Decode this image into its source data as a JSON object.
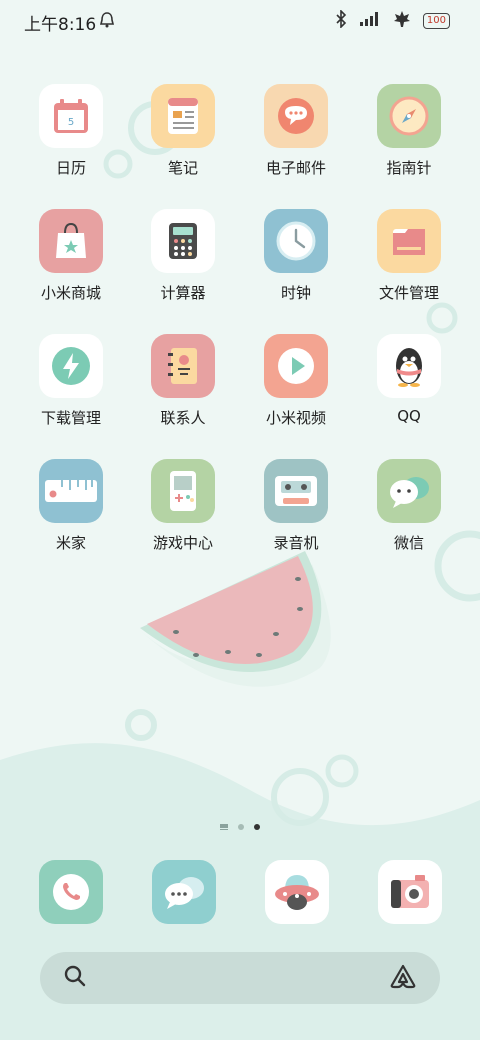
{
  "status_bar": {
    "time": "上午8:16",
    "alarm_icon": "alarm-bell-icon",
    "bluetooth_icon": "bluetooth-icon",
    "signal_icon": "signal-bars-icon",
    "wifi_icon": "maple-leaf-wifi-icon",
    "battery_level": "100"
  },
  "apps": [
    {
      "label": "日历",
      "icon": "calendar-icon",
      "color": "#ffffff"
    },
    {
      "label": "笔记",
      "icon": "notes-icon",
      "color": "#fbd9a0"
    },
    {
      "label": "电子邮件",
      "icon": "email-icon",
      "color": "#f8d8b0"
    },
    {
      "label": "指南针",
      "icon": "compass-icon",
      "color": "#b4d3a4"
    },
    {
      "label": "小米商城",
      "icon": "shopping-bag-icon",
      "color": "#e7a1a1"
    },
    {
      "label": "计算器",
      "icon": "calculator-icon",
      "color": "#ffffff"
    },
    {
      "label": "时钟",
      "icon": "clock-icon",
      "color": "#8fc1d2"
    },
    {
      "label": "文件管理",
      "icon": "folder-icon",
      "color": "#fbd9a0"
    },
    {
      "label": "下载管理",
      "icon": "download-bolt-icon",
      "color": "#ffffff"
    },
    {
      "label": "联系人",
      "icon": "contacts-book-icon",
      "color": "#e7a1a1"
    },
    {
      "label": "小米视频",
      "icon": "video-play-icon",
      "color": "#f3a491"
    },
    {
      "label": "QQ",
      "icon": "penguin-icon",
      "color": "#ffffff"
    },
    {
      "label": "米家",
      "icon": "ruler-home-icon",
      "color": "#8fc1d2"
    },
    {
      "label": "游戏中心",
      "icon": "gameboy-icon",
      "color": "#b4d3a4"
    },
    {
      "label": "录音机",
      "icon": "cassette-icon",
      "color": "#9ec3c4"
    },
    {
      "label": "微信",
      "icon": "chat-bubbles-icon",
      "color": "#b4d3a4"
    }
  ],
  "dock": [
    {
      "name": "phone",
      "icon": "phone-icon",
      "color": "#8fcfbb"
    },
    {
      "name": "messages",
      "icon": "message-bubbles-icon",
      "color": "#8fcfcf"
    },
    {
      "name": "browser",
      "icon": "ufo-icon",
      "color": "#ffffff"
    },
    {
      "name": "camera",
      "icon": "camera-icon",
      "color": "#ffffff"
    }
  ],
  "page_indicator": {
    "pages": 3,
    "active": 3
  },
  "search_bar": {
    "search_icon": "search-icon",
    "assistant_icon": "xiaoai-assistant-icon"
  }
}
